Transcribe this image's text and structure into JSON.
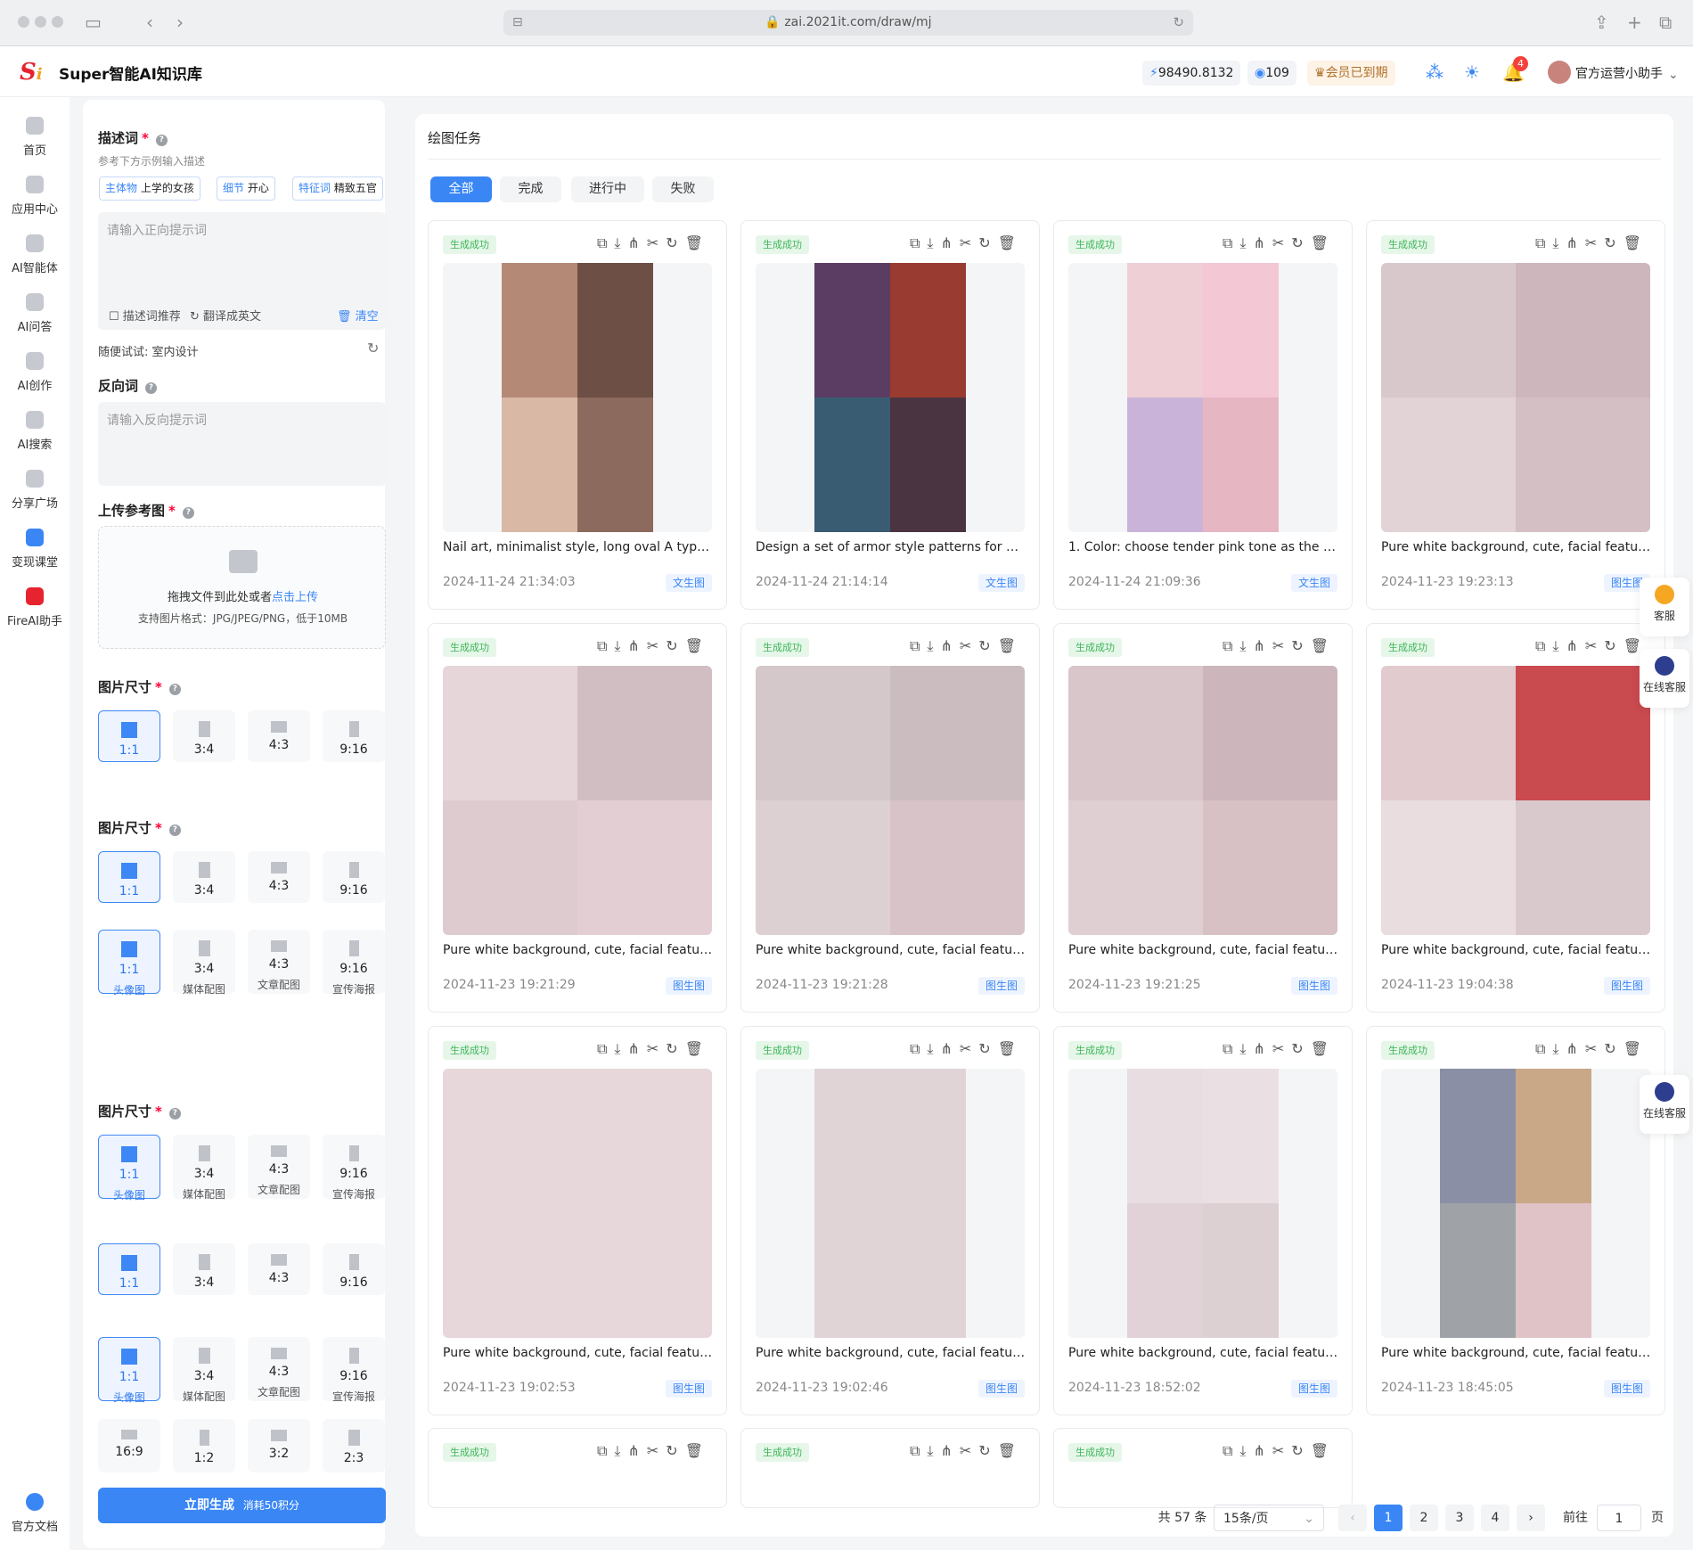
{
  "browser": {
    "url": "zai.2021it.com/draw/mj"
  },
  "header": {
    "brand": "Super智能AI知识库",
    "points": "98490.8132",
    "coins": "109",
    "member": "会员已到期",
    "notifications": "4",
    "user": "官方运营小助手"
  },
  "sidebar": {
    "items": [
      "首页",
      "应用中心",
      "AI智能体",
      "AI问答",
      "AI创作",
      "AI搜索",
      "分享广场",
      "变现课堂",
      "FireAI助手"
    ],
    "docs": "官方文档"
  },
  "left": {
    "prompt_label": "描述词",
    "prompt_hint": "参考下方示例输入描述",
    "tags": [
      {
        "k": "主体物",
        "v": "上学的女孩"
      },
      {
        "k": "细节",
        "v": "开心"
      },
      {
        "k": "特征词",
        "v": "精致五官"
      }
    ],
    "prompt_placeholder": "请输入正向提示词",
    "recommend": "描述词推荐",
    "translate": "翻译成英文",
    "clear": "清空",
    "try_label": "随便试试:",
    "try_value": "室内设计",
    "negative_label": "反向词",
    "negative_placeholder": "请输入反向提示词",
    "upload_label": "上传参考图",
    "upload_text": "拖拽文件到此处或者",
    "upload_link": "点击上传",
    "upload_formats": "支持图片格式：JPG/JPEG/PNG，低于10MB",
    "size_label": "图片尺寸",
    "ratios": [
      "1:1",
      "3:4",
      "4:3",
      "9:16"
    ],
    "ratio_subs": [
      "头像图",
      "媒体配图",
      "文章配图",
      "宣传海报"
    ],
    "extra_ratios": [
      "16:9",
      "1:2",
      "3:2",
      "2:3"
    ],
    "generate": "立即生成",
    "cost": "消耗50积分"
  },
  "main": {
    "title": "绘图任务",
    "tabs": [
      "全部",
      "完成",
      "进行中",
      "失败"
    ],
    "status": "生成成功",
    "cards": [
      {
        "cap": "Nail art, minimalist style, long oval A type,...",
        "date": "2024-11-24 21:34:03",
        "tag": "文生图"
      },
      {
        "cap": "Design a set of armor style patterns for me,...",
        "date": "2024-11-24 21:14:14",
        "tag": "文生图"
      },
      {
        "cap": "1. Color: choose tender pink tone as the ba...",
        "date": "2024-11-24 21:09:36",
        "tag": "文生图"
      },
      {
        "cap": "Pure white background, cute, facial feature...",
        "date": "2024-11-23 19:23:13",
        "tag": "图生图"
      },
      {
        "cap": "Pure white background, cute, facial feature...",
        "date": "2024-11-23 19:21:29",
        "tag": "图生图"
      },
      {
        "cap": "Pure white background, cute, facial feature...",
        "date": "2024-11-23 19:21:28",
        "tag": "图生图"
      },
      {
        "cap": "Pure white background, cute, facial feature...",
        "date": "2024-11-23 19:21:25",
        "tag": "图生图"
      },
      {
        "cap": "Pure white background, cute, facial feature...",
        "date": "2024-11-23 19:04:38",
        "tag": "图生图"
      },
      {
        "cap": "Pure white background, cute, facial feature...",
        "date": "2024-11-23 19:02:53",
        "tag": "图生图"
      },
      {
        "cap": "Pure white background, cute, facial feature...",
        "date": "2024-11-23 19:02:46",
        "tag": "图生图"
      },
      {
        "cap": "Pure white background, cute, facial feature...",
        "date": "2024-11-23 18:52:02",
        "tag": "图生图"
      },
      {
        "cap": "Pure white background, cute, facial feature...",
        "date": "2024-11-23 18:45:05",
        "tag": "图生图"
      }
    ],
    "total": "共 57 条",
    "per_page": "15条/页",
    "pages": [
      "1",
      "2",
      "3",
      "4"
    ],
    "goto": "前往",
    "goto_value": "1",
    "page_unit": "页"
  },
  "floater": {
    "service": "客服",
    "online": "在线客服"
  }
}
